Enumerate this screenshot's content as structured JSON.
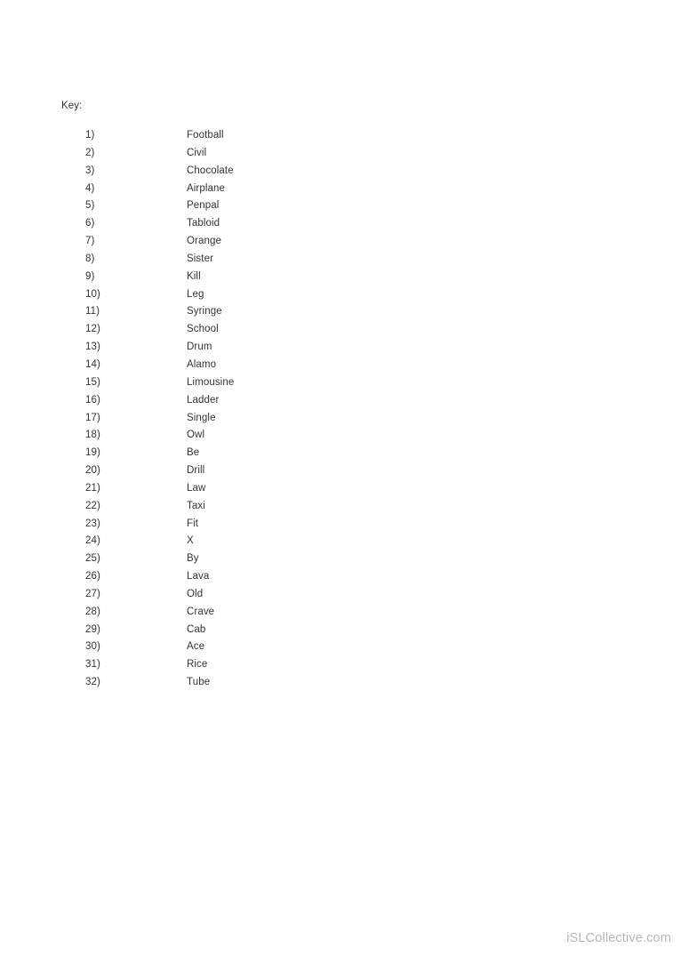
{
  "document": {
    "heading": "Key:",
    "background_color": "#ffffff",
    "text_color": "#333333"
  },
  "answer_key": {
    "items": [
      {
        "number": "1)",
        "answer": "Football"
      },
      {
        "number": "2)",
        "answer": "Civil"
      },
      {
        "number": "3)",
        "answer": "Chocolate"
      },
      {
        "number": "4)",
        "answer": "Airplane"
      },
      {
        "number": "5)",
        "answer": "Penpal"
      },
      {
        "number": "6)",
        "answer": "Tabloid"
      },
      {
        "number": "7)",
        "answer": "Orange"
      },
      {
        "number": "8)",
        "answer": "Sister"
      },
      {
        "number": "9)",
        "answer": "Kill"
      },
      {
        "number": "10)",
        "answer": "Leg"
      },
      {
        "number": "11)",
        "answer": "Syringe"
      },
      {
        "number": "12)",
        "answer": "School"
      },
      {
        "number": "13)",
        "answer": "Drum"
      },
      {
        "number": "14)",
        "answer": "Alamo"
      },
      {
        "number": "15)",
        "answer": "Limousine"
      },
      {
        "number": "16)",
        "answer": "Ladder"
      },
      {
        "number": "17)",
        "answer": "Single"
      },
      {
        "number": "18)",
        "answer": "Owl"
      },
      {
        "number": "19)",
        "answer": "Be"
      },
      {
        "number": "20)",
        "answer": "Drill"
      },
      {
        "number": "21)",
        "answer": "Law"
      },
      {
        "number": "22)",
        "answer": "Taxi"
      },
      {
        "number": "23)",
        "answer": "Fit"
      },
      {
        "number": "24)",
        "answer": "X"
      },
      {
        "number": "25)",
        "answer": "By"
      },
      {
        "number": "26)",
        "answer": "Lava"
      },
      {
        "number": "27)",
        "answer": "Old"
      },
      {
        "number": "28)",
        "answer": "Crave"
      },
      {
        "number": "29)",
        "answer": "Cab"
      },
      {
        "number": "30)",
        "answer": "Ace"
      },
      {
        "number": "31)",
        "answer": "Rice"
      },
      {
        "number": "32)",
        "answer": "Tube"
      }
    ]
  },
  "footer": {
    "watermark": "iSLCollective.com",
    "color": "#b6b6b6"
  }
}
